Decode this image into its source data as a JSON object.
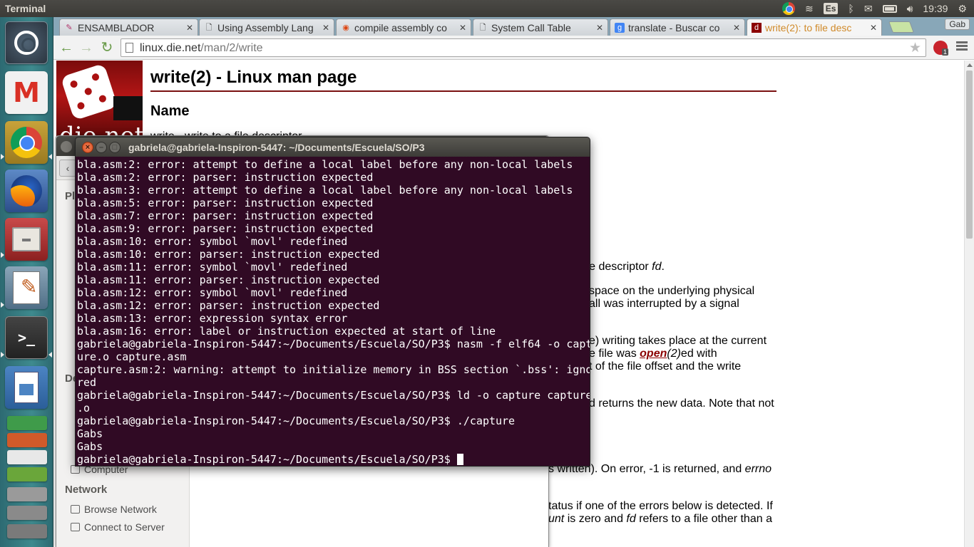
{
  "top_panel": {
    "app_title": "Terminal",
    "language": "Es",
    "user": "Gab",
    "clock": "19:39"
  },
  "launcher": {
    "items": [
      {
        "name": "Ubuntu Dash",
        "icon": "ubuntu-logo-icon"
      },
      {
        "name": "Gmail",
        "icon": "gmail-icon"
      },
      {
        "name": "Chromium / Chrome",
        "icon": "chrome-icon"
      },
      {
        "name": "Firefox",
        "icon": "firefox-icon"
      },
      {
        "name": "Files",
        "icon": "files-icon"
      },
      {
        "name": "Text Editor",
        "icon": "text-editor-icon"
      },
      {
        "name": "Terminal",
        "icon": "terminal-icon"
      },
      {
        "name": "Writer",
        "icon": "writer-icon"
      }
    ]
  },
  "browser": {
    "tabs": [
      {
        "label": "ENSAMBLADOR",
        "favicon": "bookmark-icon"
      },
      {
        "label": "Using Assembly Lang",
        "favicon": "page-icon"
      },
      {
        "label": "compile assembly co",
        "favicon": "ubuntu-icon"
      },
      {
        "label": "System Call Table",
        "favicon": "page-icon"
      },
      {
        "label": "translate - Buscar co",
        "favicon": "google-icon"
      },
      {
        "label": "write(2): to file desc",
        "favicon": "dienet-icon"
      }
    ],
    "active_tab": 5,
    "profile": "Gab",
    "url_host": "linux.die.net",
    "url_path": "/man/2/write",
    "ext_badge": "1"
  },
  "page": {
    "logo_text": "die.net",
    "title": "write(2) - Linux man page",
    "section_name": "Name",
    "name_line": "write - write to a file descriptor",
    "frags": {
      "f1_pre": "ile descriptor ",
      "f1_em": "fd",
      "f1_post": ".",
      "f2": "space on the underlying physical",
      "f3": "all was interrupted by a signal",
      "f4": "e) writing takes place at the current",
      "f5_pre": "e file was ",
      "f5_link": "open",
      "f5_link_em": "(2)",
      "f5_post": "ed with",
      "f6": "t of the file offset and the write",
      "f7": "d returns the new data. Note that not",
      "f8_pre": "s written). On error, -1 is returned, and ",
      "f8_em": "errno",
      "f9": "tatus if one of the errors below is detected. If",
      "f10_em": "unt",
      "f10_mid": " is zero and ",
      "f10_em2": "fd",
      "f10_post": " refers to a file other than a"
    }
  },
  "file_manager": {
    "sidebar_heading_places": "Pl",
    "sidebar_heading_devices": "De",
    "device_computer": "Computer",
    "sidebar_heading_network": "Network",
    "network_items": [
      "Browse Network",
      "Connect to Server"
    ]
  },
  "terminal": {
    "title": "gabriela@gabriela-Inspiron-5447: ~/Documents/Escuela/SO/P3",
    "lines": [
      "bla.asm:2: error: attempt to define a local label before any non-local labels",
      "bla.asm:2: error: parser: instruction expected",
      "bla.asm:3: error: attempt to define a local label before any non-local labels",
      "bla.asm:5: error: parser: instruction expected",
      "bla.asm:7: error: parser: instruction expected",
      "bla.asm:9: error: parser: instruction expected",
      "bla.asm:10: error: symbol `movl' redefined",
      "bla.asm:10: error: parser: instruction expected",
      "bla.asm:11: error: symbol `movl' redefined",
      "bla.asm:11: error: parser: instruction expected",
      "bla.asm:12: error: symbol `movl' redefined",
      "bla.asm:12: error: parser: instruction expected",
      "bla.asm:13: error: expression syntax error",
      "bla.asm:16: error: label or instruction expected at start of line",
      "gabriela@gabriela-Inspiron-5447:~/Documents/Escuela/SO/P3$ nasm -f elf64 -o capt",
      "ure.o capture.asm",
      "capture.asm:2: warning: attempt to initialize memory in BSS section `.bss': igno",
      "red",
      "gabriela@gabriela-Inspiron-5447:~/Documents/Escuela/SO/P3$ ld -o capture capture",
      ".o",
      "gabriela@gabriela-Inspiron-5447:~/Documents/Escuela/SO/P3$ ./capture",
      "Gabs",
      "Gabs"
    ],
    "prompt": "gabriela@gabriela-Inspiron-5447:~/Documents/Escuela/SO/P3$ "
  }
}
